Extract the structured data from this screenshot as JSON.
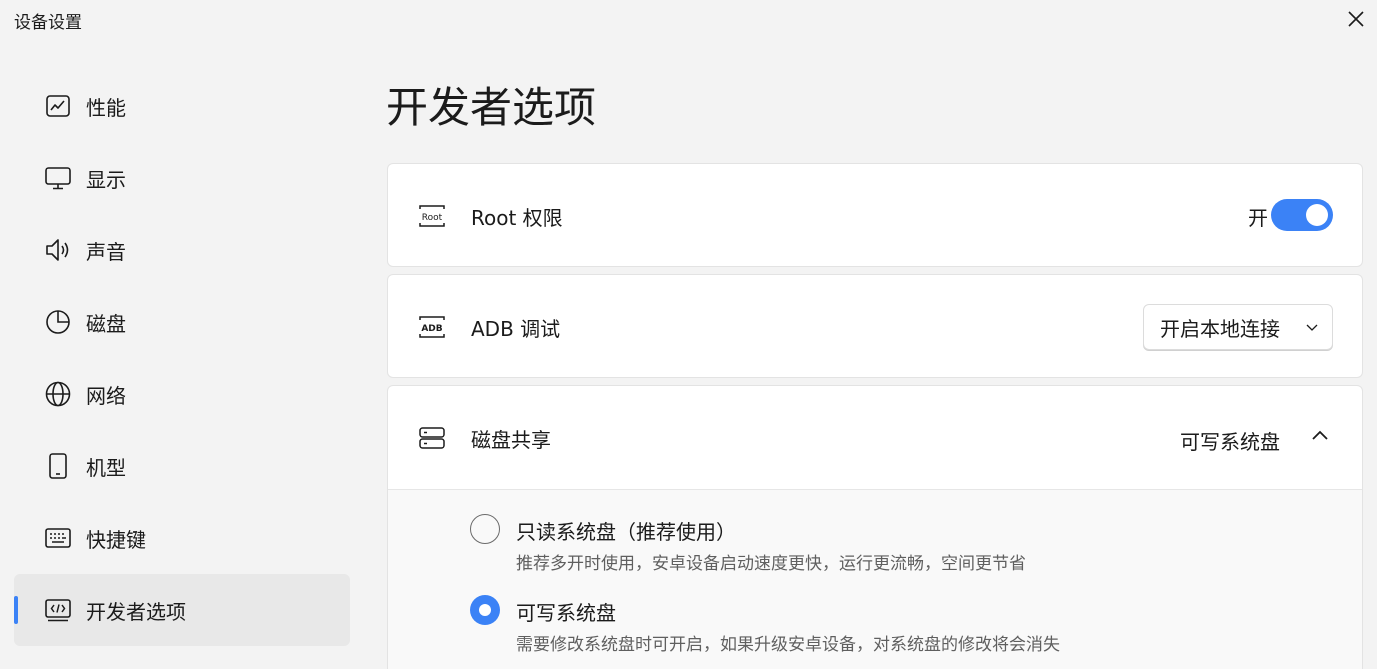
{
  "window": {
    "title": "设备设置"
  },
  "sidebar": {
    "items": [
      {
        "label": "性能",
        "icon": "performance-chart-icon"
      },
      {
        "label": "显示",
        "icon": "monitor-icon"
      },
      {
        "label": "声音",
        "icon": "speaker-icon"
      },
      {
        "label": "磁盘",
        "icon": "pie-chart-icon"
      },
      {
        "label": "网络",
        "icon": "globe-icon"
      },
      {
        "label": "机型",
        "icon": "phone-icon"
      },
      {
        "label": "快捷键",
        "icon": "keyboard-icon"
      },
      {
        "label": "开发者选项",
        "icon": "developer-code-icon",
        "active": true
      }
    ]
  },
  "main": {
    "title": "开发者选项",
    "root": {
      "icon_text": "Root",
      "label": "Root 权限",
      "state_text": "开",
      "enabled": true
    },
    "adb": {
      "icon_text": "ADB",
      "label": "ADB 调试",
      "selected": "开启本地连接"
    },
    "disk_share": {
      "label": "磁盘共享",
      "value": "可写系统盘",
      "options": [
        {
          "title": "只读系统盘（推荐使用）",
          "desc": "推荐多开时使用，安卓设备启动速度更快，运行更流畅，空间更节省",
          "selected": false
        },
        {
          "title": "可写系统盘",
          "desc": "需要修改系统盘时可开启，如果升级安卓设备，对系统盘的修改将会消失",
          "selected": true
        }
      ]
    }
  },
  "colors": {
    "accent": "#3b82f6",
    "background": "#f3f3f3",
    "card": "#ffffff"
  }
}
